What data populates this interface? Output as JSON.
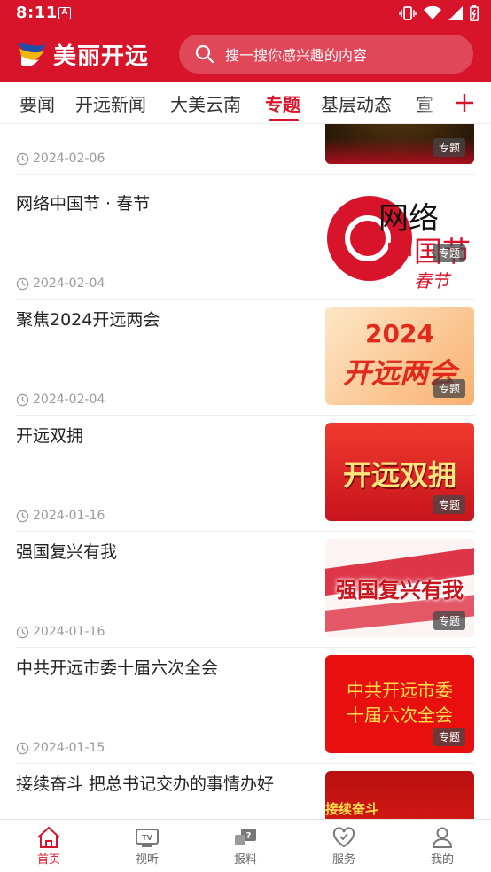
{
  "status": {
    "time": "8:11",
    "notification": "A"
  },
  "header": {
    "logo_text": "美丽开远",
    "search_placeholder": "搜一搜你感兴趣的内容"
  },
  "tabs": [
    {
      "label": "要闻"
    },
    {
      "label": "开远新闻"
    },
    {
      "label": "大美云南"
    },
    {
      "label": "专题"
    },
    {
      "label": "基层动态"
    },
    {
      "label": "宣"
    }
  ],
  "badge_label": "专题",
  "feed": {
    "top_partial": {
      "date": "2024-02-06"
    },
    "items": [
      {
        "title": "网络中国节 · 春节",
        "date": "2024-02-04",
        "thumb_lines": [
          "网络",
          "中国节",
          "春节"
        ]
      },
      {
        "title": "聚焦2024开远两会",
        "date": "2024-02-04",
        "thumb_lines": [
          "2024",
          "开远两会"
        ]
      },
      {
        "title": "开远双拥",
        "date": "2024-01-16",
        "thumb_lines": [
          "开远双拥"
        ]
      },
      {
        "title": "强国复兴有我",
        "date": "2024-01-16",
        "thumb_lines": [
          "强国复兴有我"
        ]
      },
      {
        "title": "中共开远市委十届六次全会",
        "date": "2024-01-15",
        "thumb_lines": [
          "中共开远市委",
          "十届六次全会"
        ]
      },
      {
        "title": "接续奋斗  把总书记交办的事情办好",
        "thumb_lines": [
          "接续奋斗"
        ]
      }
    ]
  },
  "bottom_nav": [
    {
      "label": "首页",
      "icon": "home-icon"
    },
    {
      "label": "视听",
      "icon": "tv-icon"
    },
    {
      "label": "报料",
      "icon": "report-icon"
    },
    {
      "label": "服务",
      "icon": "heart-icon"
    },
    {
      "label": "我的",
      "icon": "user-icon"
    }
  ],
  "colors": {
    "brand": "#d8142b",
    "muted": "#9a9a9a"
  }
}
